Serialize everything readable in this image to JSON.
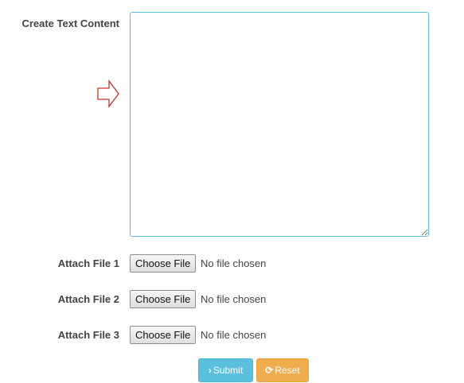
{
  "form": {
    "content_label": "Create Text Content",
    "content_value": "",
    "attachments": [
      {
        "label": "Attach File 1",
        "button": "Choose File",
        "status": "No file chosen"
      },
      {
        "label": "Attach File 2",
        "button": "Choose File",
        "status": "No file chosen"
      },
      {
        "label": "Attach File 3",
        "button": "Choose File",
        "status": "No file chosen"
      }
    ],
    "submit_label": "Submit",
    "reset_label": "Reset"
  },
  "icons": {
    "pointer": "arrow-right-outline-icon",
    "submit": "chevron-right-icon",
    "reset": "refresh-icon"
  },
  "colors": {
    "textarea_border": "#5bc0de",
    "submit_bg": "#5bc0de",
    "reset_bg": "#f0ad4e",
    "arrow_stroke": "#c9302c"
  }
}
